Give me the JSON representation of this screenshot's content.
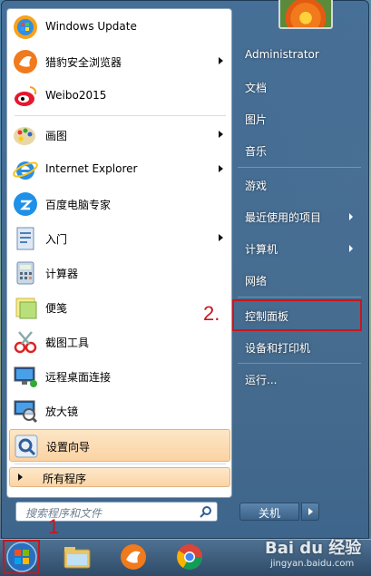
{
  "left_programs": [
    {
      "label": "Windows Update",
      "icon": "windows-update-icon",
      "arrow": false
    },
    {
      "label": "猎豹安全浏览器",
      "icon": "cheetah-browser-icon",
      "arrow": true
    },
    {
      "label": "Weibo2015",
      "icon": "weibo-icon",
      "arrow": false
    },
    {
      "label": "画图",
      "icon": "paint-icon",
      "arrow": true
    },
    {
      "label": "Internet Explorer",
      "icon": "internet-explorer-icon",
      "arrow": true
    },
    {
      "label": "百度电脑专家",
      "icon": "baidu-expert-icon",
      "arrow": false
    },
    {
      "label": "入门",
      "icon": "getting-started-icon",
      "arrow": true
    },
    {
      "label": "计算器",
      "icon": "calculator-icon",
      "arrow": false
    },
    {
      "label": "便笺",
      "icon": "sticky-notes-icon",
      "arrow": false
    },
    {
      "label": "截图工具",
      "icon": "snipping-tool-icon",
      "arrow": false
    },
    {
      "label": "远程桌面连接",
      "icon": "remote-desktop-icon",
      "arrow": false
    },
    {
      "label": "放大镜",
      "icon": "magnifier-icon",
      "arrow": false
    },
    {
      "label": "设置向导",
      "icon": "setup-wizard-icon",
      "arrow": false
    }
  ],
  "all_programs_label": "所有程序",
  "search": {
    "placeholder": "搜索程序和文件"
  },
  "right_items": [
    {
      "label": "Administrator",
      "arrow": false
    },
    {
      "label": "文档",
      "arrow": false
    },
    {
      "label": "图片",
      "arrow": false
    },
    {
      "label": "音乐",
      "arrow": false
    },
    {
      "label": "游戏",
      "arrow": false
    },
    {
      "label": "最近使用的项目",
      "arrow": true
    },
    {
      "label": "计算机",
      "arrow": true
    },
    {
      "label": "网络",
      "arrow": false
    },
    {
      "label": "控制面板",
      "arrow": false
    },
    {
      "label": "设备和打印机",
      "arrow": false
    },
    {
      "label": "运行...",
      "arrow": false
    }
  ],
  "shutdown_label": "关机",
  "annotations": {
    "step1": "1",
    "step2": "2."
  },
  "watermark": {
    "text": "Bai du 经验",
    "sub": "jingyan.baidu.com"
  },
  "colors": {
    "highlight": "#c8161d",
    "selected": "#fbd3a3"
  }
}
